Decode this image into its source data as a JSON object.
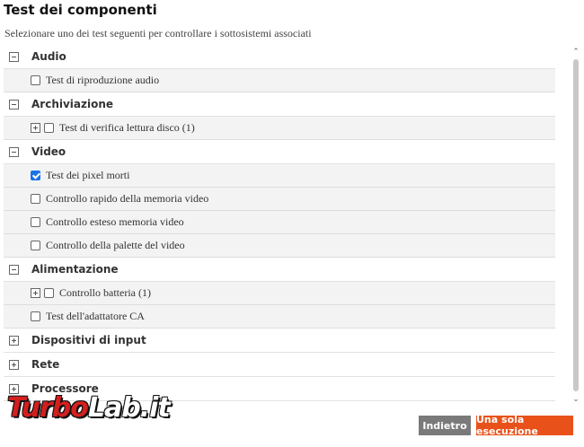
{
  "header": {
    "title": "Test dei componenti",
    "subtitle": "Selezionare uno dei test seguenti per controllare i sottosistemi associati"
  },
  "groups": [
    {
      "label": "Audio",
      "expanded": true,
      "items": [
        {
          "label": "Test di riproduzione audio",
          "checked": false,
          "expandable": false
        }
      ]
    },
    {
      "label": "Archiviazione",
      "expanded": true,
      "items": [
        {
          "label": "Test di verifica lettura disco (1)",
          "checked": false,
          "expandable": true
        }
      ]
    },
    {
      "label": "Video",
      "expanded": true,
      "items": [
        {
          "label": "Test dei pixel morti",
          "checked": true,
          "expandable": false
        },
        {
          "label": "Controllo rapido della memoria video",
          "checked": false,
          "expandable": false
        },
        {
          "label": "Controllo esteso memoria video",
          "checked": false,
          "expandable": false
        },
        {
          "label": "Controllo della palette del video",
          "checked": false,
          "expandable": false
        }
      ]
    },
    {
      "label": "Alimentazione",
      "expanded": true,
      "items": [
        {
          "label": "Controllo batteria (1)",
          "checked": false,
          "expandable": true
        },
        {
          "label": "Test dell'adattatore CA",
          "checked": false,
          "expandable": false
        }
      ]
    },
    {
      "label": "Dispositivi di input",
      "expanded": false,
      "items": []
    },
    {
      "label": "Rete",
      "expanded": false,
      "items": []
    },
    {
      "label": "Processore",
      "expanded": false,
      "items": []
    }
  ],
  "footer": {
    "back_label": "Indietro",
    "run_label": "Una sola esecuzione"
  },
  "watermark": {
    "part1": "Turbo",
    "part2": "Lab.it"
  },
  "icons": {
    "collapse": "minus-box-icon",
    "expand": "plus-box-icon",
    "scroll_up": "chevron-up-icon",
    "scroll_down": "chevron-down-icon"
  },
  "colors": {
    "accent": "#e8521a",
    "secondary_button": "#7a7a7a",
    "checkbox_checked": "#1a73e8",
    "watermark_red": "#d41f1f"
  }
}
